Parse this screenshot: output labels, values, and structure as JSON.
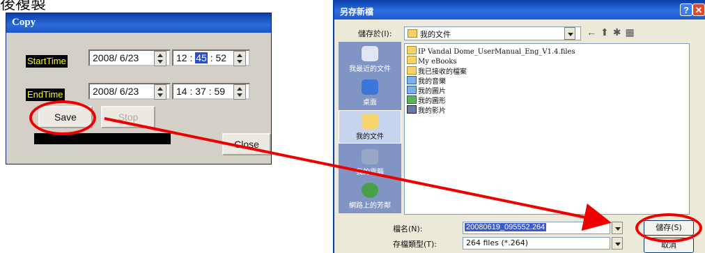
{
  "page": {
    "heading_partial": "後複製"
  },
  "copy_dialog": {
    "title": "Copy",
    "start_time": {
      "label": "StartTime",
      "date": "2008/ 6/23",
      "hour": "12",
      "minute": "45",
      "second": "52"
    },
    "end_time": {
      "label": "EndTime",
      "date": "2008/ 6/23",
      "time": "14 : 37 : 59"
    },
    "save_label": "Save",
    "stop_label": "Stop",
    "close_label": "Close"
  },
  "save_dialog": {
    "title": "另存新檔",
    "help_glyph": "?",
    "close_glyph": "✕",
    "save_in_label": "儲存於(I):",
    "save_in_value": "我的文件",
    "places": [
      {
        "label": "我最近的文件",
        "icon": "recent-documents-icon"
      },
      {
        "label": "桌面",
        "icon": "desktop-icon"
      },
      {
        "label": "我的文件",
        "icon": "my-documents-icon"
      },
      {
        "label": "我的電腦",
        "icon": "my-computer-icon"
      },
      {
        "label": "網路上的芳鄰",
        "icon": "network-places-icon"
      }
    ],
    "files": [
      {
        "name": "IP Vandal Dome_UserManual_Eng_V1.4.files",
        "icon": "folder-icon"
      },
      {
        "name": "My eBooks",
        "icon": "folder-icon"
      },
      {
        "name": "我已接收的檔案",
        "icon": "folder-icon"
      },
      {
        "name": "我的音樂",
        "icon": "music-folder-icon"
      },
      {
        "name": "我的圖片",
        "icon": "pictures-folder-icon"
      },
      {
        "name": "我的圖形",
        "icon": "shapes-folder-icon"
      },
      {
        "name": "我的影片",
        "icon": "video-folder-icon"
      }
    ],
    "filename_label": "檔名(N):",
    "filename_value": "20080619_095552.264",
    "filetype_label": "存檔類型(T):",
    "filetype_value": "264 files (*.264)",
    "save_button": "儲存(S)",
    "cancel_button": "取消"
  },
  "colors": {
    "callout": "#e00000",
    "xp_title": "#0a3ea8"
  }
}
